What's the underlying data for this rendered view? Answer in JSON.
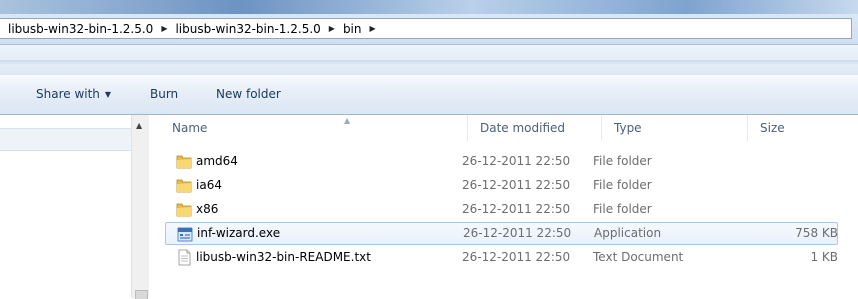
{
  "address": {
    "crumbs": [
      "libusb-win32-bin-1.2.5.0",
      "libusb-win32-bin-1.2.5.0",
      "bin"
    ]
  },
  "toolbar": {
    "share_with_label": "Share with",
    "burn_label": "Burn",
    "new_folder_label": "New folder"
  },
  "columns": {
    "name": "Name",
    "date_modified": "Date modified",
    "type": "Type",
    "size": "Size"
  },
  "files": [
    {
      "name": "amd64",
      "date": "26-12-2011 22:50",
      "type": "File folder",
      "size": "",
      "icon": "folder-icon"
    },
    {
      "name": "ia64",
      "date": "26-12-2011 22:50",
      "type": "File folder",
      "size": "",
      "icon": "folder-icon"
    },
    {
      "name": "x86",
      "date": "26-12-2011 22:50",
      "type": "File folder",
      "size": "",
      "icon": "folder-icon"
    },
    {
      "name": "inf-wizard.exe",
      "date": "26-12-2011 22:50",
      "type": "Application",
      "size": "758 KB",
      "icon": "application-icon",
      "selected": true
    },
    {
      "name": "libusb-win32-bin-README.txt",
      "date": "26-12-2011 22:50",
      "type": "Text Document",
      "size": "1 KB",
      "icon": "text-document-icon"
    }
  ]
}
